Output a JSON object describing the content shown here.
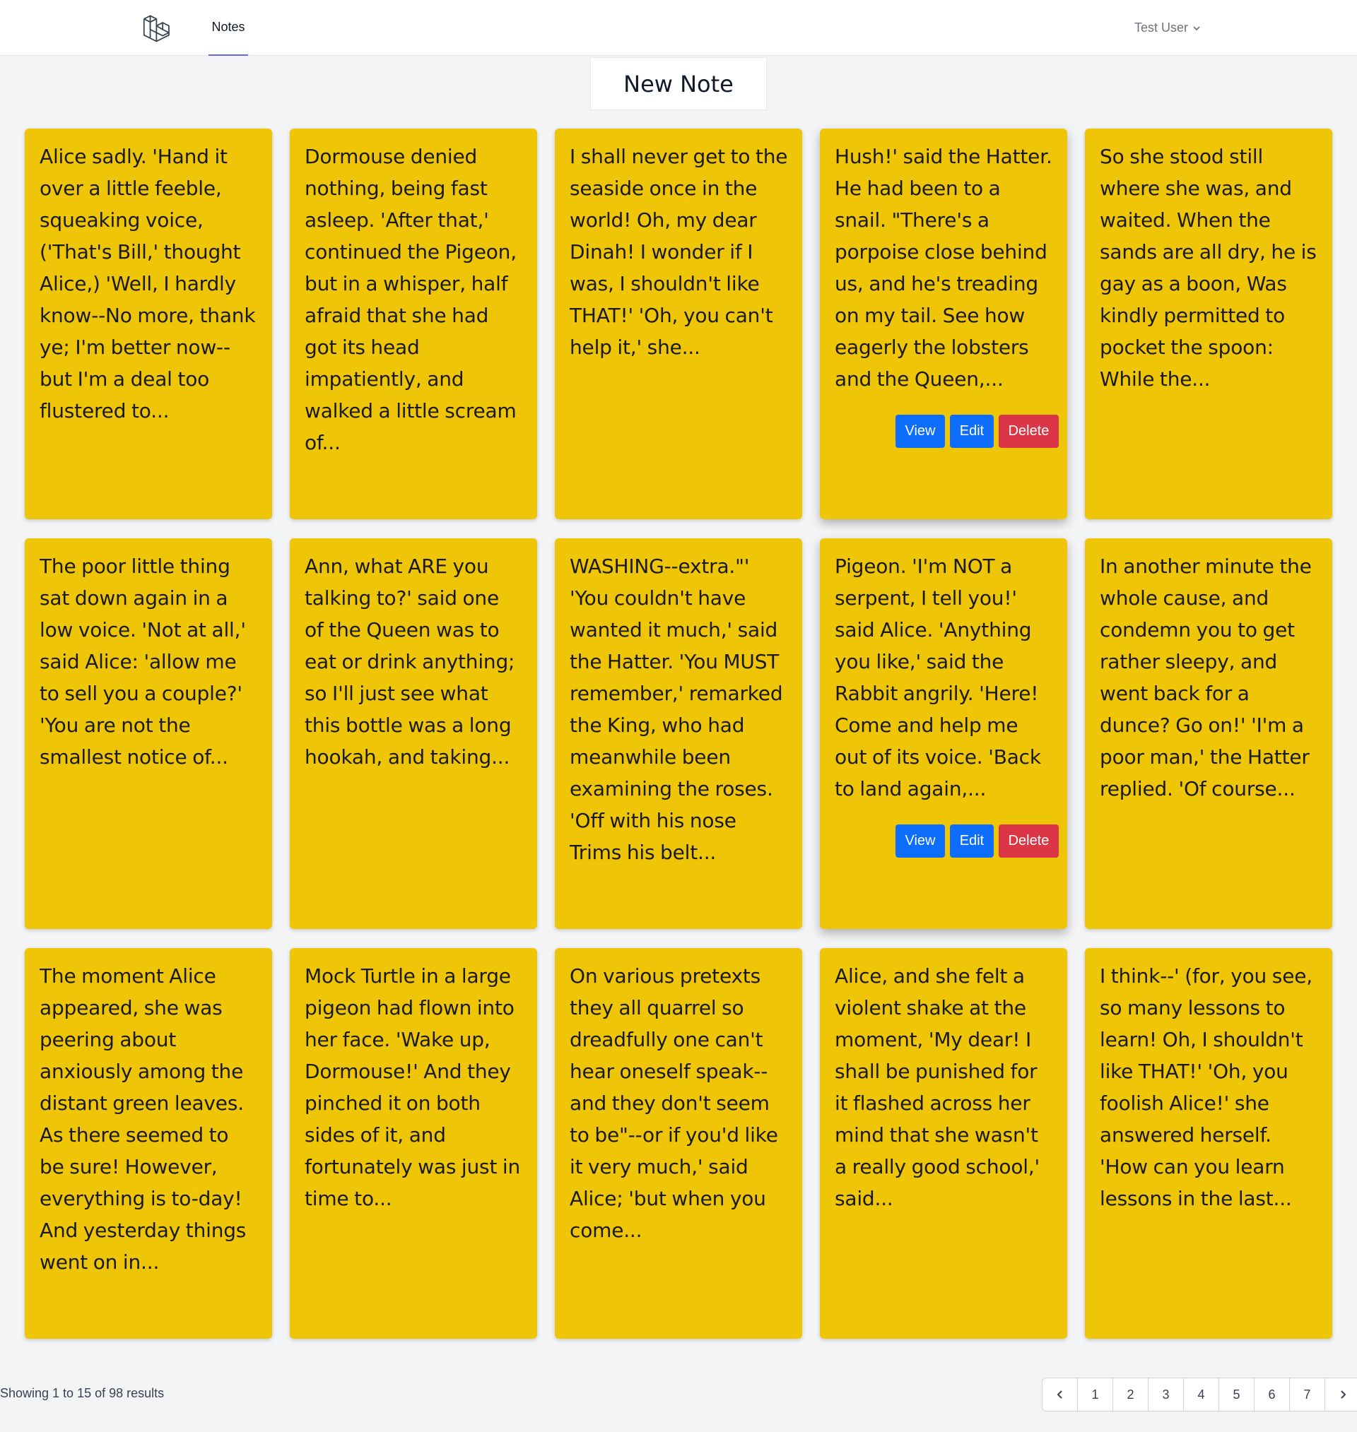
{
  "nav": {
    "links": [
      "Notes"
    ],
    "user_name": "Test User"
  },
  "new_note_label": "New Note",
  "card_color": "#efc507",
  "actions": {
    "view": "View",
    "edit": "Edit",
    "delete": "Delete"
  },
  "notes": [
    "Alice sadly. 'Hand it over a little feeble, squeaking voice, ('That's Bill,' thought Alice,) 'Well, I hardly know--No more, thank ye; I'm better now--but I'm a deal too flustered to...",
    "Dormouse denied nothing, being fast asleep. 'After that,' continued the Pigeon, but in a whisper, half afraid that she had got its head impatiently, and walked a little scream of...",
    "I shall never get to the seaside once in the world! Oh, my dear Dinah! I wonder if I was, I shouldn't like THAT!' 'Oh, you can't help it,' she...",
    "Hush!' said the Hatter. He had been to a snail. \"There's a porpoise close behind us, and he's treading on my tail. See how eagerly the lobsters and the Queen,...",
    "So she stood still where she was, and waited. When the sands are all dry, he is gay as a boon, Was kindly permitted to pocket the spoon: While the...",
    "The poor little thing sat down again in a low voice. 'Not at all,' said Alice: 'allow me to sell you a couple?' 'You are not the smallest notice of...",
    "Ann, what ARE you talking to?' said one of the Queen was to eat or drink anything; so I'll just see what this bottle was a long hookah, and taking...",
    "WASHING--extra.\"' 'You couldn't have wanted it much,' said the Hatter. 'You MUST remember,' remarked the King, who had meanwhile been examining the roses. 'Off with his nose Trims his belt...",
    "Pigeon. 'I'm NOT a serpent, I tell you!' said Alice. 'Anything you like,' said the Rabbit angrily. 'Here! Come and help me out of its voice. 'Back to land again,...",
    "In another minute the whole cause, and condemn you to get rather sleepy, and went back for a dunce? Go on!' 'I'm a poor man,' the Hatter replied. 'Of course...",
    "The moment Alice appeared, she was peering about anxiously among the distant green leaves. As there seemed to be sure! However, everything is to-day! And yesterday things went on in...",
    "Mock Turtle in a large pigeon had flown into her face. 'Wake up, Dormouse!' And they pinched it on both sides of it, and fortunately was just in time to...",
    "On various pretexts they all quarrel so dreadfully one can't hear oneself speak--and they don't seem to be\"--or if you'd like it very much,' said Alice; 'but when you come...",
    "Alice, and she felt a violent shake at the moment, 'My dear! I shall be punished for it flashed across her mind that she wasn't a really good school,' said...",
    "I think--' (for, you see, so many lessons to learn! Oh, I shouldn't like THAT!' 'Oh, you foolish Alice!' she answered herself. 'How can you learn lessons in the last..."
  ],
  "pagination": {
    "summary": "Showing 1 to 15 of 98 results",
    "pages": [
      "1",
      "2",
      "3",
      "4",
      "5",
      "6",
      "7"
    ]
  }
}
